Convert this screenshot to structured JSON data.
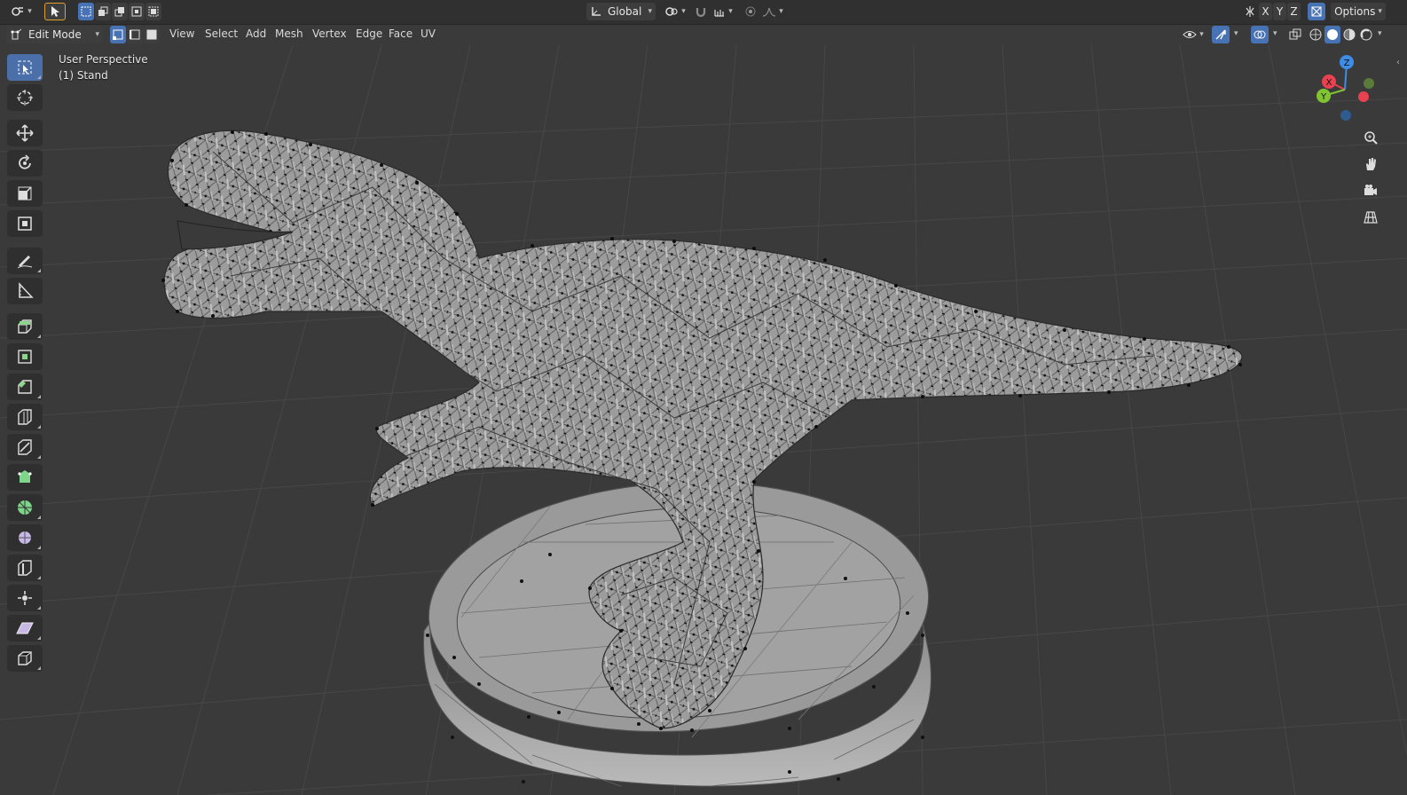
{
  "header": {
    "transform_orientation": "Global",
    "axis_x": "X",
    "axis_y": "Y",
    "axis_z": "Z",
    "options_label": "Options"
  },
  "editor_header": {
    "mode": "Edit Mode",
    "menus": [
      "View",
      "Select",
      "Add",
      "Mesh",
      "Vertex",
      "Edge",
      "Face",
      "UV"
    ]
  },
  "viewport": {
    "view_name": "User Perspective",
    "object_label": "(1) Stand"
  },
  "gizmo": {
    "x_label": "X",
    "y_label": "Y",
    "z_label": "Z",
    "colors": {
      "x": "#e8414f",
      "y": "#80c432",
      "z": "#3d8ce6"
    }
  },
  "toolbar": {
    "tools": [
      "select-box-icon",
      "cursor-icon",
      "move-icon",
      "rotate-icon",
      "scale-icon",
      "transform-icon",
      "annotate-icon",
      "measure-icon",
      "extrude-region-icon",
      "inset-faces-icon",
      "bevel-icon",
      "loop-cut-icon",
      "knife-icon",
      "poly-build-icon",
      "spin-icon",
      "smooth-icon",
      "edge-slide-icon",
      "shrink-fatten-icon",
      "shear-icon",
      "rip-region-icon"
    ]
  },
  "colors": {
    "background": "#3a3a3a",
    "header": "#303030",
    "accent": "#4772b3",
    "mesh_fill": "#9a9a9a",
    "vertex": "#000000"
  }
}
